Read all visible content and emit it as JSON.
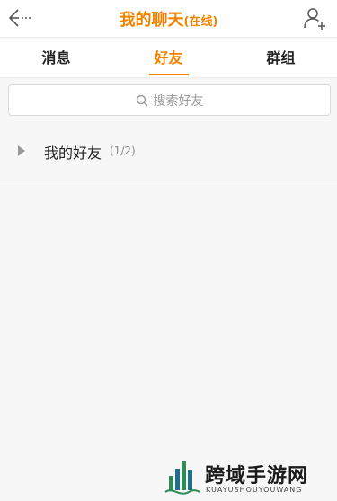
{
  "header": {
    "title": "我的聊天",
    "status": "(在线)"
  },
  "tabs": [
    {
      "label": "消息",
      "active": false
    },
    {
      "label": "好友",
      "active": true
    },
    {
      "label": "群组",
      "active": false
    }
  ],
  "search": {
    "placeholder": "搜索好友"
  },
  "friend_groups": [
    {
      "name": "我的好友",
      "count": "(1/2)"
    }
  ],
  "watermark": {
    "title": "跨域手游网",
    "subtitle": "KUAYUSHOUYOUWANG"
  },
  "colors": {
    "accent": "#f08300",
    "background": "#f7f7f7"
  }
}
